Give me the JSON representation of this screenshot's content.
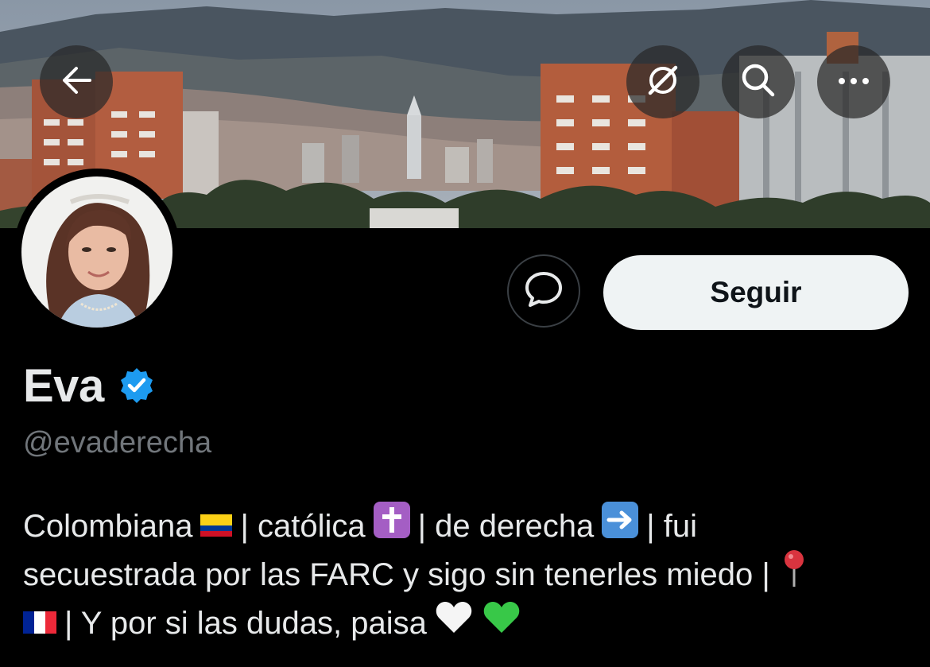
{
  "header": {
    "back_icon": "arrow-left-icon",
    "grok_icon": "grok-icon",
    "search_icon": "search-icon",
    "more_icon": "more-horizontal-icon"
  },
  "profile": {
    "display_name": "Eva",
    "verified": true,
    "handle": "@evaderecha",
    "actions": {
      "message_icon": "message-bubble-icon",
      "follow_label": "Seguir"
    },
    "bio": {
      "line1": [
        {
          "text": "Colombiana"
        },
        {
          "emoji": "colombia-flag"
        },
        {
          "text": "| católica"
        },
        {
          "emoji": "latin-cross"
        },
        {
          "text": "| de derecha"
        },
        {
          "emoji": "right-arrow"
        },
        {
          "text": "| fui"
        }
      ],
      "line2": [
        {
          "text": "secuestrada por las FARC y sigo sin tenerles miedo |"
        },
        {
          "emoji": "round-pushpin"
        }
      ],
      "line3": [
        {
          "emoji": "france-flag"
        },
        {
          "text": "| Y por si las dudas, paisa"
        },
        {
          "emoji": "white-heart"
        },
        {
          "emoji": "green-heart"
        }
      ]
    }
  },
  "colors": {
    "background": "#000000",
    "text_primary": "#e7e9ea",
    "text_secondary": "#71767b",
    "verified_blue": "#1d9bf0",
    "follow_bg": "#eff3f4"
  }
}
